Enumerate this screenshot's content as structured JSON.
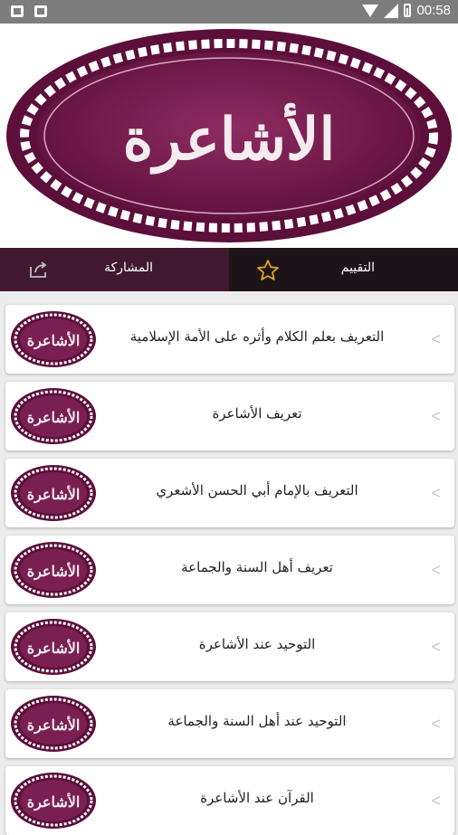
{
  "status_bar": {
    "time": "00:58"
  },
  "header": {
    "logo_text": "الأشاعرة"
  },
  "tabs": [
    {
      "id": "share",
      "label": "المشاركة",
      "icon": "share-icon"
    },
    {
      "id": "rate",
      "label": "التقييم",
      "icon": "star-icon"
    }
  ],
  "items": [
    {
      "title": "التعريف بعلم الكلام وأثره على الأمة الإسلامية"
    },
    {
      "title": "تعريف الأشاعرة"
    },
    {
      "title": "التعريف بالإمام أبي الحسن الأشعري"
    },
    {
      "title": "تعريف أهل السنة والجماعة"
    },
    {
      "title": "التوحيد عند الأشاعرة"
    },
    {
      "title": "التوحيد عند أهل السنة والجماعة"
    },
    {
      "title": "القرآن عند الأشاعرة"
    }
  ],
  "list_logo_text": "الأشاعرة",
  "chevron": "<",
  "colors": {
    "brand": "#7a1f52",
    "tab_active": "#401830",
    "tab_bg": "#1d1419",
    "star": "#e0a52a"
  }
}
